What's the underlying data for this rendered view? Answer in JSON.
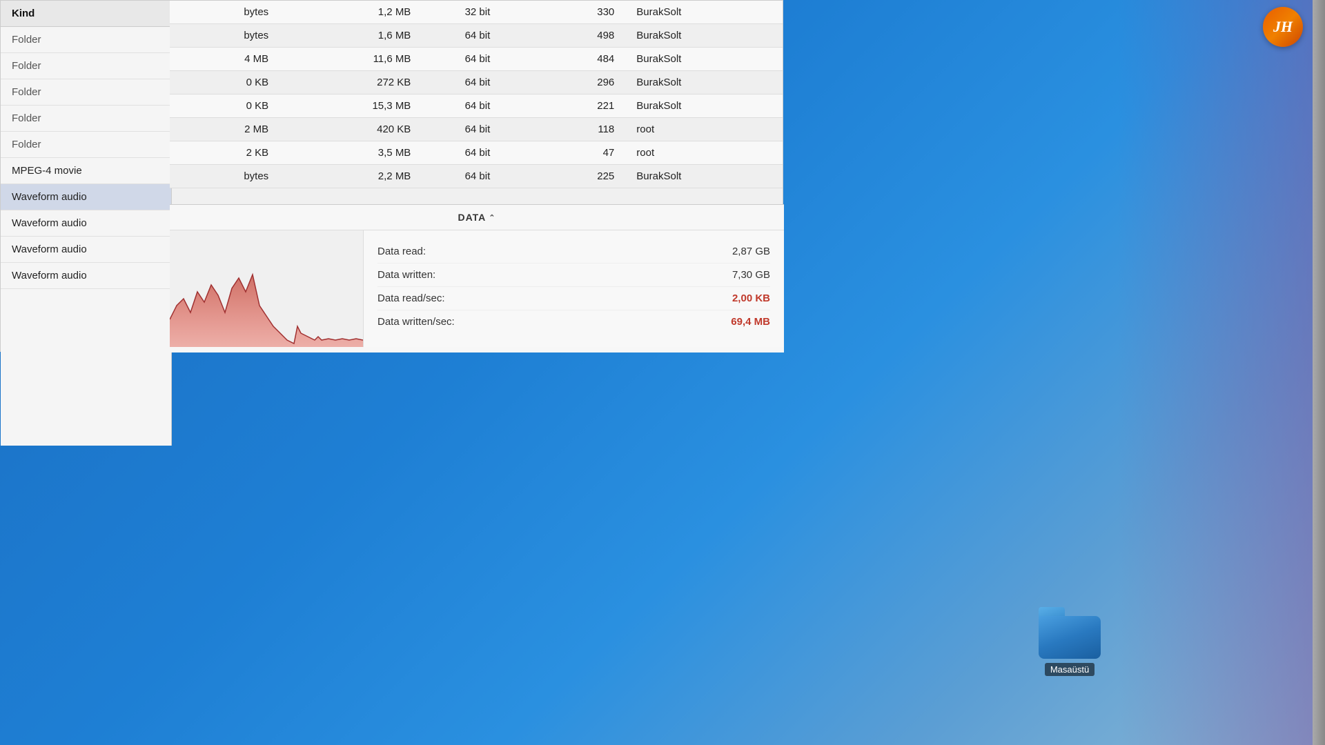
{
  "desktop": {
    "background": "#1a6bbf"
  },
  "sidebar": {
    "header": "Kind",
    "items": [
      {
        "label": "Folder",
        "type": "folder"
      },
      {
        "label": "Folder",
        "type": "folder"
      },
      {
        "label": "Folder",
        "type": "folder"
      },
      {
        "label": "Folder",
        "type": "folder"
      },
      {
        "label": "Folder",
        "type": "folder"
      },
      {
        "label": "MPEG-4 movie",
        "type": "mpeg"
      },
      {
        "label": "Waveform audio",
        "type": "waveform"
      },
      {
        "label": "Waveform audio",
        "type": "waveform"
      },
      {
        "label": "Waveform audio",
        "type": "waveform"
      },
      {
        "label": "Waveform audio",
        "type": "waveform"
      }
    ]
  },
  "table": {
    "rows": [
      {
        "col1": "bytes",
        "col2": "1,2 MB",
        "col3": "32 bit",
        "col4": "330",
        "col5": "BurakSolt"
      },
      {
        "col1": "bytes",
        "col2": "1,6 MB",
        "col3": "64 bit",
        "col4": "498",
        "col5": "BurakSolt"
      },
      {
        "col1": "4 MB",
        "col2": "11,6 MB",
        "col3": "64 bit",
        "col4": "484",
        "col5": "BurakSolt"
      },
      {
        "col1": "0 KB",
        "col2": "272 KB",
        "col3": "64 bit",
        "col4": "296",
        "col5": "BurakSolt"
      },
      {
        "col1": "0 KB",
        "col2": "15,3 MB",
        "col3": "64 bit",
        "col4": "221",
        "col5": "BurakSolt"
      },
      {
        "col1": "2 MB",
        "col2": "420 KB",
        "col3": "64 bit",
        "col4": "118",
        "col5": "root"
      },
      {
        "col1": "2 KB",
        "col2": "3,5 MB",
        "col3": "64 bit",
        "col4": "47",
        "col5": "root"
      },
      {
        "col1": "bytes",
        "col2": "2,2 MB",
        "col3": "64 bit",
        "col4": "225",
        "col5": "BurakSolt"
      }
    ]
  },
  "data_panel": {
    "header": "DATA",
    "sort_arrows": "⌃",
    "stats": [
      {
        "label": "Data read:",
        "value": "2,87 GB",
        "highlight": false
      },
      {
        "label": "Data written:",
        "value": "7,30 GB",
        "highlight": false
      },
      {
        "label": "Data read/sec:",
        "value": "2,00 KB",
        "highlight": true
      },
      {
        "label": "Data written/sec:",
        "value": "69,4 MB",
        "highlight": true
      }
    ]
  },
  "folder_icon": {
    "label": "Masaüstü"
  },
  "logo": {
    "text": "JH"
  }
}
